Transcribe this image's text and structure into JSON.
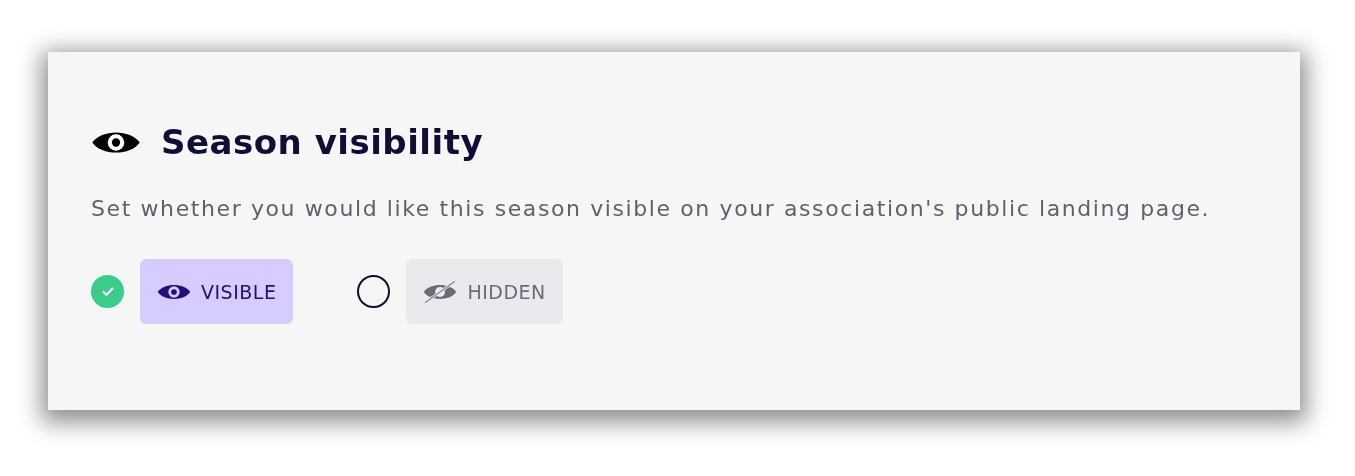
{
  "title": "Season visibility",
  "description": "Set whether you would like this season visible on your association's public landing page.",
  "options": [
    {
      "kind": "visible",
      "label": "VISIBLE",
      "selected": true
    },
    {
      "kind": "hidden",
      "label": "HIDDEN",
      "selected": false
    }
  ]
}
